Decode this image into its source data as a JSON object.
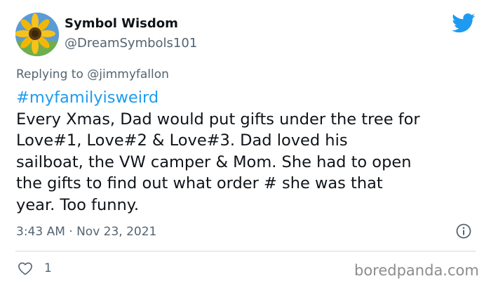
{
  "user": {
    "display_name": "Symbol Wisdom",
    "handle": "@DreamSymbols101",
    "avatar": "sunflower-avatar"
  },
  "reply": {
    "prefix": "Replying to",
    "mention": "@jimmyfallon"
  },
  "tweet": {
    "hashtag": "#myfamilyisweird",
    "lines": [
      "Every Xmas, Dad would put gifts under the tree for",
      "Love#1, Love#2 & Love#3.  Dad loved his",
      "sailboat, the VW camper & Mom.  She had to open",
      "the gifts to find out what order # she was that",
      "year.  Too funny."
    ],
    "timestamp": "3:43 AM · Nov 23, 2021"
  },
  "actions": {
    "like_icon": "heart-icon",
    "like_count": "1",
    "info_icon": "info-icon"
  },
  "watermark": "boredpanda.com",
  "colors": {
    "twitter_blue": "#1d9bf0",
    "text": "#0f1419",
    "secondary": "#536471"
  }
}
